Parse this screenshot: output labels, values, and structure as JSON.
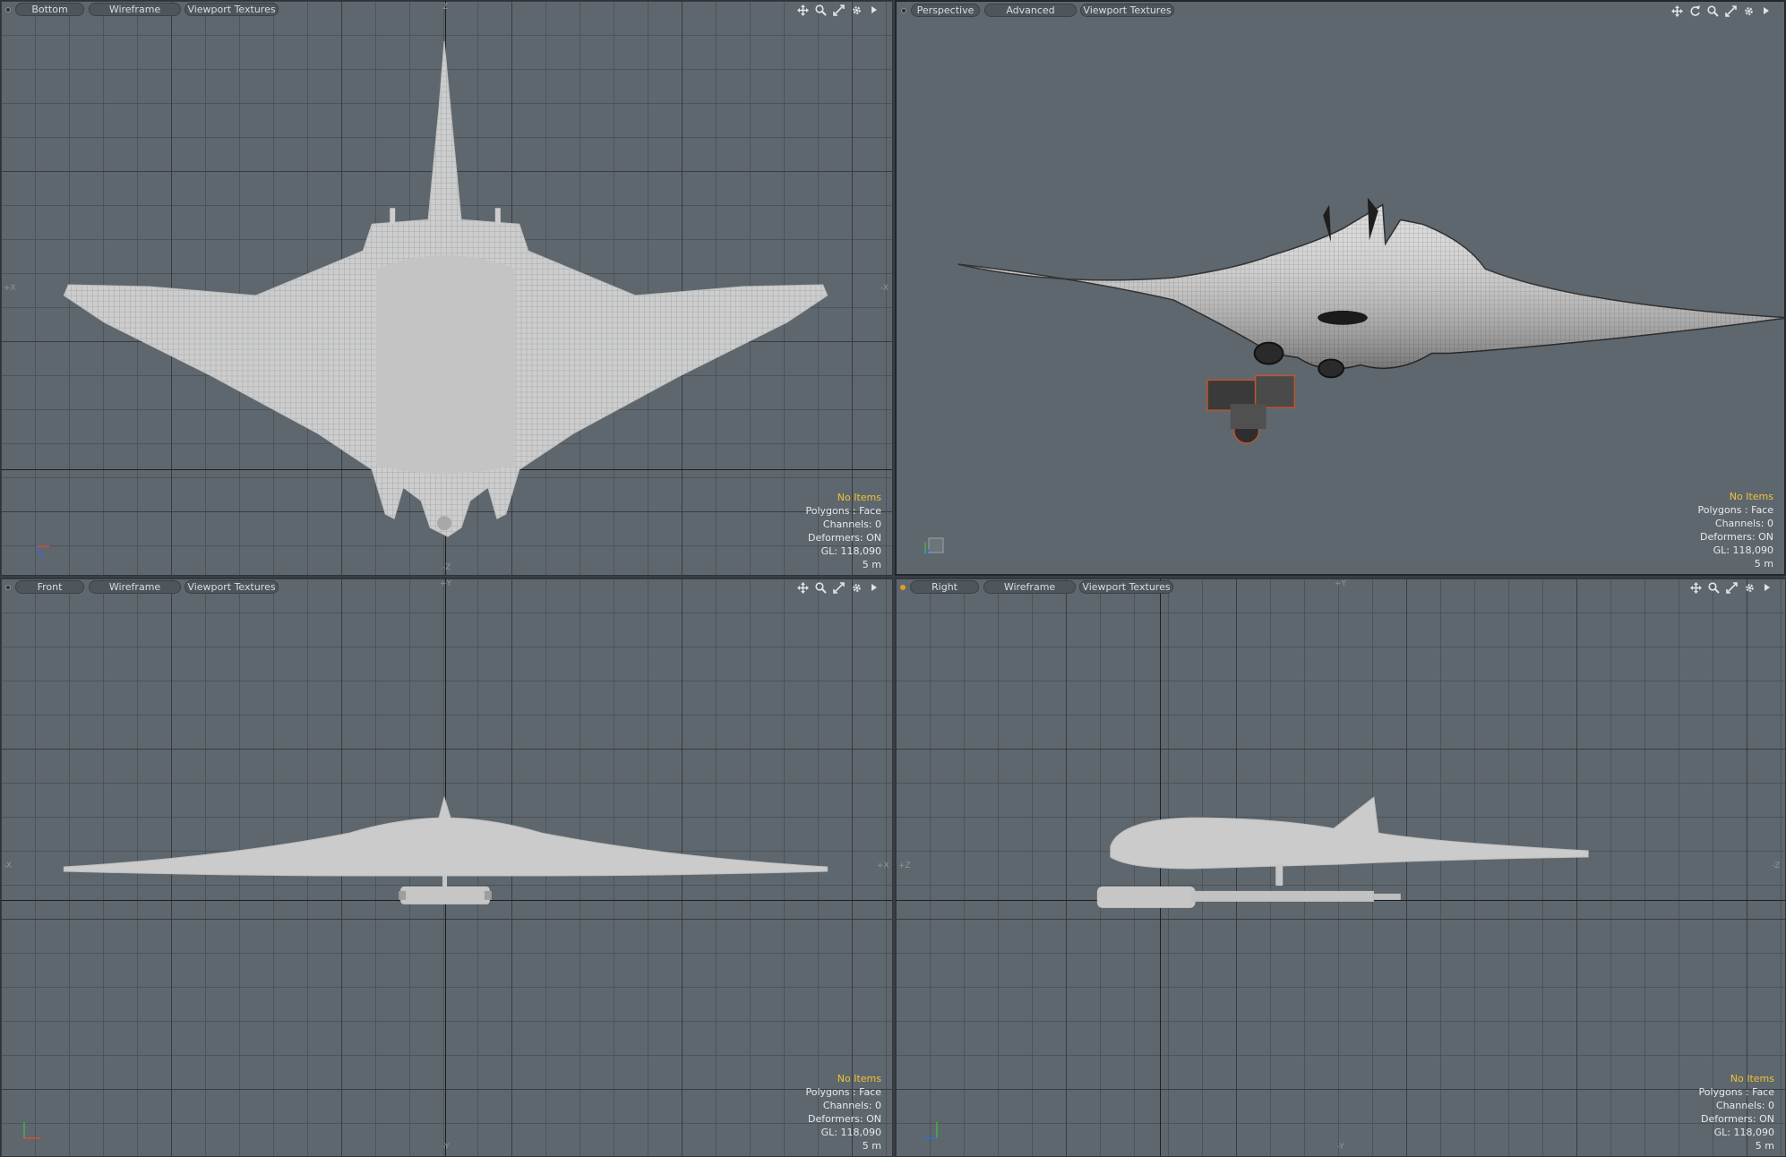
{
  "viewports": {
    "top_left": {
      "view": "Bottom",
      "shading": "Wireframe",
      "textures": "Viewport Textures",
      "axis_top": "Z",
      "axis_bottom": "-Z",
      "axis_left": "+X",
      "axis_right": "-X",
      "hud": {
        "status": "No Items",
        "polygons": "Polygons : Face",
        "channels": "Channels: 0",
        "deformers": "Deformers: ON",
        "gl": "GL: 118,090",
        "scale": "5 m"
      }
    },
    "top_right": {
      "view": "Perspective",
      "shading": "Advanced",
      "textures": "Viewport Textures",
      "hud": {
        "status": "No Items",
        "polygons": "Polygons : Face",
        "channels": "Channels: 0",
        "deformers": "Deformers: ON",
        "gl": "GL: 118,090",
        "scale": "5 m"
      }
    },
    "bottom_left": {
      "view": "Front",
      "shading": "Wireframe",
      "textures": "Viewport Textures",
      "axis_top": "+Y",
      "axis_bottom": "-Y",
      "axis_left": "-X",
      "axis_right": "+X",
      "hud": {
        "status": "No Items",
        "polygons": "Polygons : Face",
        "channels": "Channels: 0",
        "deformers": "Deformers: ON",
        "gl": "GL: 118,090",
        "scale": "5 m"
      }
    },
    "bottom_right": {
      "view": "Right",
      "shading": "Wireframe",
      "textures": "Viewport Textures",
      "axis_top": "+Y",
      "axis_bottom": "-Y",
      "axis_left": "+Z",
      "axis_right": "-Z",
      "hud": {
        "status": "No Items",
        "polygons": "Polygons : Face",
        "channels": "Channels: 0",
        "deformers": "Deformers: ON",
        "gl": "GL: 118,090",
        "scale": "5 m"
      }
    }
  },
  "icons": [
    "pan-icon",
    "zoom-icon",
    "fit-icon",
    "settings-gear-icon",
    "menu-arrow-icon",
    "rotate-icon"
  ],
  "colors": {
    "viewport_bg": "#5e676d",
    "hud_highlight": "#f0c239",
    "mesh": "#c8c8c8"
  }
}
